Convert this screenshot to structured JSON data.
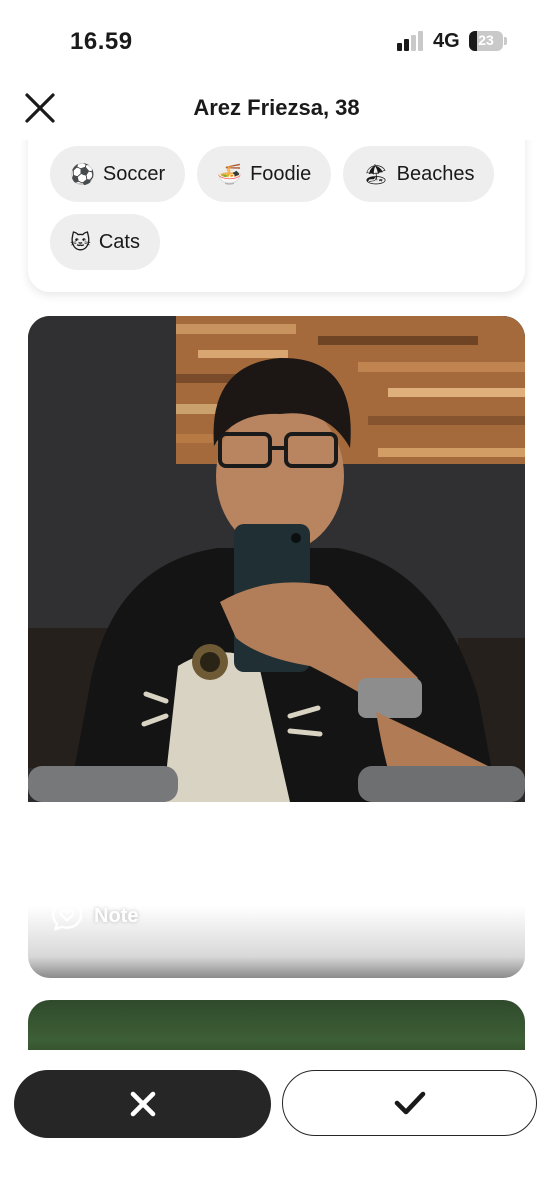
{
  "status_bar": {
    "time": "16.59",
    "network": "4G",
    "battery": "23",
    "battery_level": 0.23
  },
  "header": {
    "title": "Arez Friezsa, 38"
  },
  "interests": [
    {
      "emoji": "⚽",
      "label": "Soccer"
    },
    {
      "emoji": "🍜",
      "label": "Foodie"
    },
    {
      "emoji": "🏖",
      "label": "Beaches"
    },
    {
      "emoji": "🐱",
      "label": "Cats"
    }
  ],
  "photo": {
    "note_label": "Note"
  },
  "icons": {
    "close": "close-icon",
    "note": "heart-bubble-icon",
    "pass": "x-icon",
    "like": "check-icon",
    "signal": "signal-icon",
    "battery": "battery-icon"
  },
  "colors": {
    "accent_dark": "#262626",
    "chip_bg": "#eeeeee"
  }
}
